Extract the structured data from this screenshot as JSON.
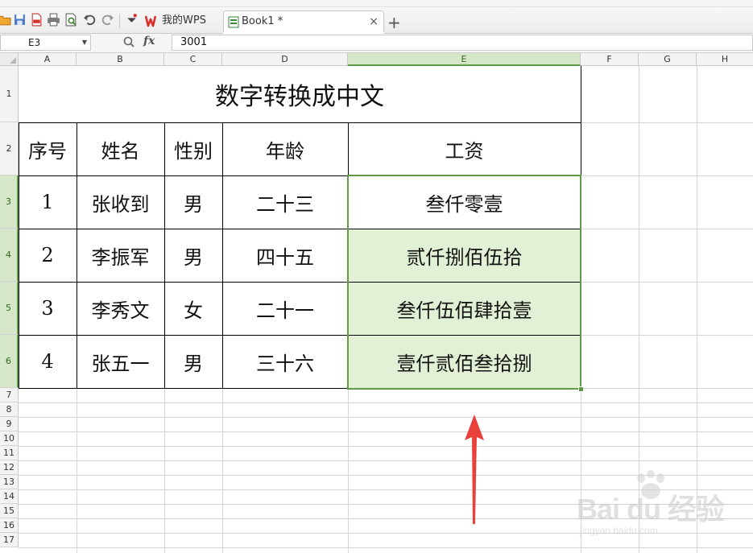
{
  "tabs": {
    "wps_label": "我的WPS",
    "book_label": "Book1 *",
    "close": "×",
    "add": "+"
  },
  "formula_bar": {
    "name_box": "E3",
    "fx_label": "fx",
    "value": "3001"
  },
  "columns": [
    "A",
    "B",
    "C",
    "D",
    "E",
    "F",
    "G",
    "H"
  ],
  "rows": [
    "1",
    "2",
    "3",
    "4",
    "5",
    "6",
    "7",
    "8",
    "9",
    "10",
    "11",
    "12",
    "13",
    "14",
    "15",
    "16",
    "17"
  ],
  "sheet": {
    "title": "数字转换成中文",
    "headers": [
      "序号",
      "姓名",
      "性别",
      "年龄",
      "工资"
    ],
    "records": [
      {
        "no": "1",
        "name": "张收到",
        "gender": "男",
        "age": "二十三",
        "salary": "叁仟零壹"
      },
      {
        "no": "2",
        "name": "李振军",
        "gender": "男",
        "age": "四十五",
        "salary": "贰仟捌佰伍拾"
      },
      {
        "no": "3",
        "name": "李秀文",
        "gender": "女",
        "age": "二十一",
        "salary": "叁仟伍佰肆拾壹"
      },
      {
        "no": "4",
        "name": "张五一",
        "gender": "男",
        "age": "三十六",
        "salary": "壹仟贰佰叁拾捌"
      }
    ]
  },
  "watermark": {
    "brand": "Bai du 经验",
    "url": "jingyan.baidu.com"
  },
  "colors": {
    "selection": "#5f9b45",
    "selection_fill": "#e2f1d5",
    "arrow": "#e8413c",
    "wps_red": "#d9302c"
  }
}
